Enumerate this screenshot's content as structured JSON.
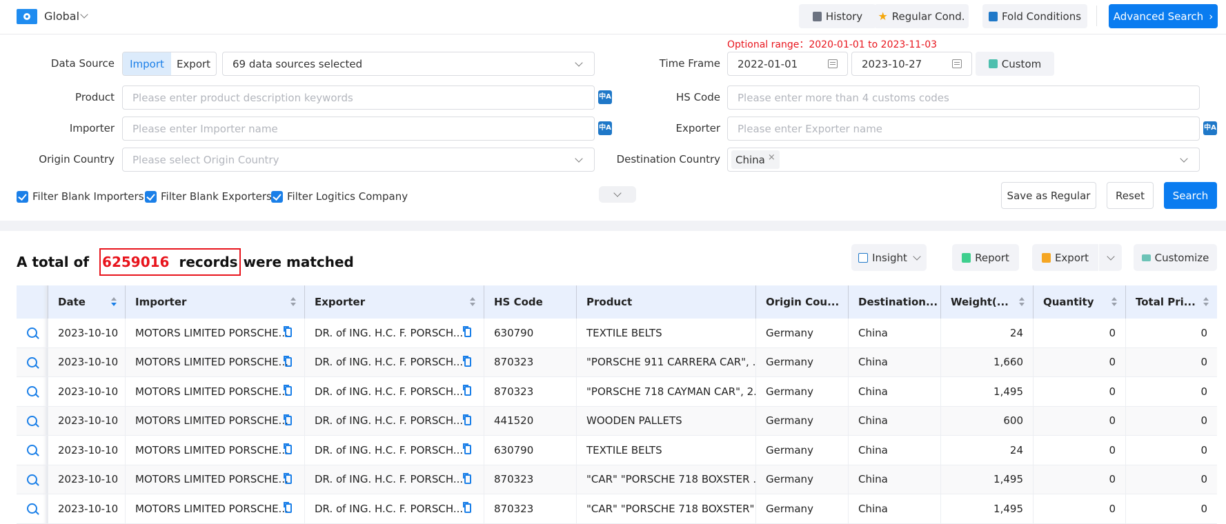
{
  "topbar": {
    "scope_label": "Global",
    "history_label": "History",
    "regular_cond_label": "Regular Cond.",
    "fold_conditions_label": "Fold Conditions",
    "advanced_search_label": "Advanced Search"
  },
  "filters": {
    "data_source": {
      "label": "Data Source",
      "import_label": "Import",
      "export_label": "Export",
      "selected": "Import",
      "sources_value": "69 data sources selected"
    },
    "product": {
      "label": "Product",
      "placeholder": "Please enter product description keywords"
    },
    "importer": {
      "label": "Importer",
      "placeholder": "Please enter Importer name"
    },
    "origin_country": {
      "label": "Origin Country",
      "placeholder": "Please select Origin Country"
    },
    "time_frame": {
      "label": "Time Frame",
      "optional_range": "Optional range：2020-01-01 to 2023-11-03",
      "start": "2022-01-01",
      "end": "2023-10-27",
      "custom_label": "Custom"
    },
    "hs_code": {
      "label": "HS Code",
      "placeholder": "Please enter more than 4 customs codes"
    },
    "exporter": {
      "label": "Exporter",
      "placeholder": "Please enter Exporter name"
    },
    "destination_country": {
      "label": "Destination Country",
      "tags": [
        "China"
      ]
    },
    "translate_icon_text": "中A",
    "checkboxes": [
      {
        "label": "Filter Blank Importers",
        "checked": true
      },
      {
        "label": "Filter Blank Exporters",
        "checked": true
      },
      {
        "label": "Filter Logitics Company",
        "checked": true
      }
    ],
    "save_regular_label": "Save as Regular",
    "reset_label": "Reset",
    "search_label": "Search"
  },
  "results": {
    "prefix": "A total of ",
    "count": "6259016",
    "records_word": "records",
    "suffix": "were matched",
    "insight_label": "Insight",
    "report_label": "Report",
    "export_label": "Export",
    "customize_label": "Customize"
  },
  "table": {
    "columns": [
      "",
      "Date",
      "Importer",
      "Exporter",
      "HS Code",
      "Product",
      "Origin Cou...",
      "Destination...",
      "Weight(...",
      "Quantity",
      "Total Pri..."
    ],
    "rows": [
      [
        "2023-10-10",
        "MOTORS LIMITED PORSCHE...",
        "DR. of ING. H.C. F. PORSCH...",
        "630790",
        "TEXTILE BELTS",
        "Germany",
        "China",
        "24",
        "0",
        "0"
      ],
      [
        "2023-10-10",
        "MOTORS LIMITED PORSCHE...",
        "DR. of ING. H.C. F. PORSCH...",
        "870323",
        "\"PORSCHE 911 CARRERA CAR\", ...",
        "Germany",
        "China",
        "1,660",
        "0",
        "0"
      ],
      [
        "2023-10-10",
        "MOTORS LIMITED PORSCHE...",
        "DR. of ING. H.C. F. PORSCH...",
        "870323",
        "\"PORSCHE 718 CAYMAN CAR\", 2...",
        "Germany",
        "China",
        "1,495",
        "0",
        "0"
      ],
      [
        "2023-10-10",
        "MOTORS LIMITED PORSCHE...",
        "DR. of ING. H.C. F. PORSCH...",
        "441520",
        "WOODEN PALLETS",
        "Germany",
        "China",
        "600",
        "0",
        "0"
      ],
      [
        "2023-10-10",
        "MOTORS LIMITED PORSCHE...",
        "DR. of ING. H.C. F. PORSCH...",
        "630790",
        "TEXTILE BELTS",
        "Germany",
        "China",
        "24",
        "0",
        "0"
      ],
      [
        "2023-10-10",
        "MOTORS LIMITED PORSCHE...",
        "DR. of ING. H.C. F. PORSCH...",
        "870323",
        "\"CAR\" \"PORSCHE 718 BOXSTER ...",
        "Germany",
        "China",
        "1,495",
        "0",
        "0"
      ],
      [
        "2023-10-10",
        "MOTORS LIMITED PORSCHE...",
        "DR. of ING. H.C. F. PORSCH...",
        "870323",
        "\"CAR\" \"PORSCHE 718 BOXSTER\"...",
        "Germany",
        "China",
        "1,495",
        "0",
        "0"
      ]
    ]
  },
  "colors": {
    "accent": "#0a7cf0",
    "highlight": "#e8141c",
    "header_bg": "#e9f0fd"
  }
}
